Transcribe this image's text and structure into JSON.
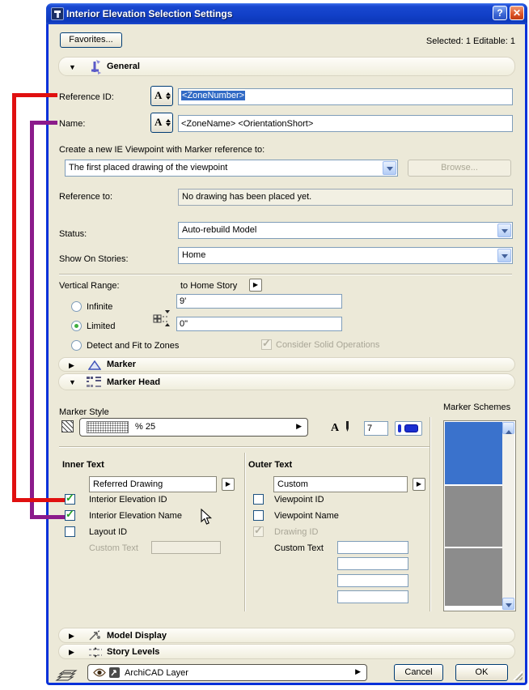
{
  "glyphs": {
    "expanded": "▼",
    "collapsed": "▶",
    "flyout": "▶",
    "check": "✓",
    "help": "?",
    "close": "✕",
    "autotext": "A",
    "font_pen": "A"
  },
  "colors": {
    "annotation_red": "#e01010",
    "annotation_purple": "#8b1b8b",
    "scheme_selected": "#3a72cc",
    "scheme_gray": "#8c8c8c",
    "selection_highlight": "#316ac5"
  },
  "window": {
    "title": "Interior Elevation Selection Settings"
  },
  "toolbar": {
    "favorites": "Favorites...",
    "selection_status": "Selected: 1 Editable: 1"
  },
  "general": {
    "title": "General",
    "reference_id_label": "Reference ID:",
    "reference_id_value": "<ZoneNumber>",
    "name_label": "Name:",
    "name_value": "<ZoneName> <OrientationShort>",
    "viewpoint_label": "Create a new IE Viewpoint with Marker reference to:",
    "viewpoint_value": "The first placed drawing of the viewpoint",
    "browse": "Browse...",
    "reference_to_label": "Reference to:",
    "reference_to_value": "No drawing has been placed yet.",
    "status_label": "Status:",
    "status_value": "Auto-rebuild Model",
    "stories_label": "Show On Stories:",
    "stories_value": "Home",
    "vertical_range_label": "Vertical Range:",
    "to_home_story": "to Home Story",
    "infinite": "Infinite",
    "limited": "Limited",
    "detect": "Detect and Fit to Zones",
    "top_value": "9'",
    "bottom_value": "0\"",
    "consider_solid": "Consider Solid Operations"
  },
  "marker": {
    "title": "Marker"
  },
  "marker_head": {
    "title": "Marker Head",
    "style_label": "Marker Style",
    "fill_value": "% 25",
    "pen_value": "7",
    "schemes_label": "Marker Schemes"
  },
  "inner_text": {
    "title": "Inner Text",
    "dropdown": "Referred Drawing",
    "item_id": "Interior Elevation ID",
    "item_name": "Interior Elevation Name",
    "item_layout": "Layout ID",
    "custom_label": "Custom Text"
  },
  "outer_text": {
    "title": "Outer Text",
    "dropdown": "Custom",
    "item_vp_id": "Viewpoint ID",
    "item_vp_name": "Viewpoint Name",
    "item_drawing": "Drawing ID",
    "custom_label": "Custom Text"
  },
  "model_display": {
    "title": "Model Display"
  },
  "story_levels": {
    "title": "Story Levels"
  },
  "footer": {
    "layer_value": "ArchiCAD Layer",
    "cancel": "Cancel",
    "ok": "OK"
  }
}
